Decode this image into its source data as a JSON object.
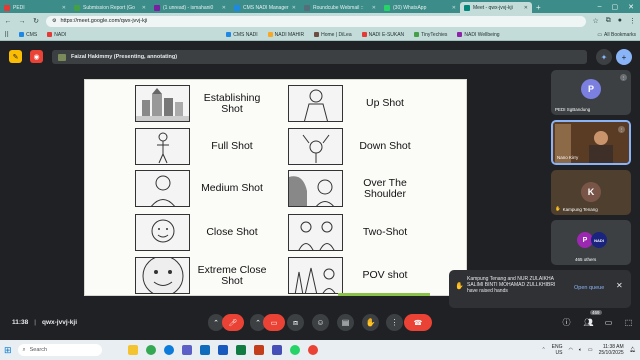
{
  "browser": {
    "tabs": [
      {
        "label": "PEDI",
        "color": "#e53935"
      },
      {
        "label": "Submission Report (Go",
        "color": "#43a047"
      },
      {
        "label": "(1 unread) - ismahani0",
        "color": "#7b1fa2"
      },
      {
        "label": "CMS NADI Manager",
        "color": "#1e88e5"
      },
      {
        "label": "Roundcube Webmail ::",
        "color": "#546e7a"
      },
      {
        "label": "(30) WhatsApp",
        "color": "#25d366"
      },
      {
        "label": "Meet - qwx-jvvj-kji",
        "color": "#00897b",
        "active": true
      }
    ],
    "url": "https://meet.google.com/qwx-jvvj-kji",
    "bookmarks": [
      {
        "label": "CMS",
        "color": "#1e88e5"
      },
      {
        "label": "NADI",
        "color": "#e53935"
      },
      {
        "label": "CMS NADI",
        "color": "#1e88e5"
      },
      {
        "label": "NADI MAHIR",
        "color": "#f9a825"
      },
      {
        "label": "Home | DiLea",
        "color": "#6d4c41"
      },
      {
        "label": "NADI E-SUKAN",
        "color": "#e53935"
      },
      {
        "label": "TinyTechies",
        "color": "#43a047"
      },
      {
        "label": "NADI Wellbeing",
        "color": "#8e24aa"
      }
    ],
    "bookmarks_right": "All Bookmarks"
  },
  "meet": {
    "presenter": "Faizal Hakimmy (Presenting, annotating)",
    "meeting_code": "qwx-jvvj-kji",
    "time": "11:38",
    "participants": [
      {
        "name": "PEDI SgBandung",
        "initial": "P",
        "avatar_color": "#7b7fe0",
        "bg": "#3c4043"
      },
      {
        "name": "Nano Kirry",
        "initial": "",
        "avatar_color": "",
        "bg": "#6b4a2f"
      },
      {
        "name": "Kampung Tenang",
        "initial": "K",
        "avatar_color": "#795548",
        "bg": "#4e3f2f"
      },
      {
        "name": "465 others",
        "initial": "P",
        "avatar_color": "#9c27b0",
        "bg": "#3c4043"
      }
    ],
    "toast": {
      "text": "Kampung Tenang and NUR ZULAIKHA SALIMI BINTI MOHAMAD ZULLKHIBRI have raised hands",
      "action": "Open queue"
    },
    "people_count": "469"
  },
  "slide": {
    "left_shots": [
      "Establishing Shot",
      "Full Shot",
      "Medium Shot",
      "Close Shot",
      "Extreme Close Shot"
    ],
    "right_shots": [
      "Up Shot",
      "Down Shot",
      "Over The Shoulder",
      "Two-Shot",
      "POV shot"
    ]
  },
  "taskbar": {
    "search_placeholder": "Search",
    "lang": "ENG",
    "region": "US",
    "time": "11:38 AM",
    "date": "25/10/2025"
  }
}
